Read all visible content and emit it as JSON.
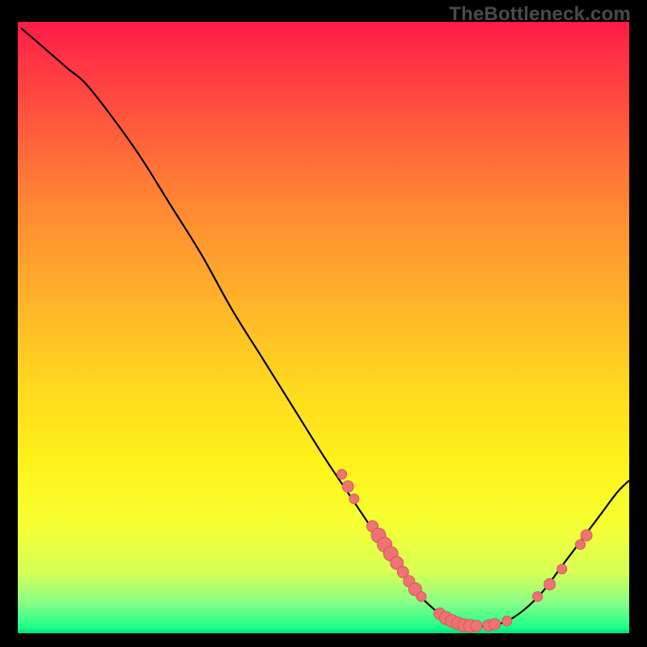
{
  "watermark_text": "TheBottleneck.com",
  "chart_data": {
    "type": "line",
    "title": "",
    "xlabel": "",
    "ylabel": "",
    "xlim": [
      0,
      100
    ],
    "ylim": [
      0,
      100
    ],
    "curve": [
      {
        "x": 0.5,
        "y": 99
      },
      {
        "x": 4,
        "y": 96
      },
      {
        "x": 8,
        "y": 92.5
      },
      {
        "x": 11,
        "y": 90
      },
      {
        "x": 15,
        "y": 85
      },
      {
        "x": 20,
        "y": 78
      },
      {
        "x": 25,
        "y": 70
      },
      {
        "x": 30,
        "y": 62
      },
      {
        "x": 35,
        "y": 53
      },
      {
        "x": 40,
        "y": 45
      },
      {
        "x": 45,
        "y": 37
      },
      {
        "x": 50,
        "y": 29
      },
      {
        "x": 54,
        "y": 23
      },
      {
        "x": 58,
        "y": 17
      },
      {
        "x": 62,
        "y": 11
      },
      {
        "x": 65,
        "y": 7
      },
      {
        "x": 68,
        "y": 4
      },
      {
        "x": 71,
        "y": 2
      },
      {
        "x": 74,
        "y": 1.2
      },
      {
        "x": 77,
        "y": 1.2
      },
      {
        "x": 80,
        "y": 2
      },
      {
        "x": 83,
        "y": 4
      },
      {
        "x": 86,
        "y": 7
      },
      {
        "x": 89,
        "y": 11
      },
      {
        "x": 92,
        "y": 15
      },
      {
        "x": 95,
        "y": 19
      },
      {
        "x": 98,
        "y": 23
      },
      {
        "x": 100,
        "y": 25
      }
    ],
    "dots": [
      {
        "x": 53,
        "y": 26,
        "r": 6
      },
      {
        "x": 54,
        "y": 24,
        "r": 7
      },
      {
        "x": 55,
        "y": 22,
        "r": 6
      },
      {
        "x": 58,
        "y": 17.5,
        "r": 7
      },
      {
        "x": 59,
        "y": 16,
        "r": 9
      },
      {
        "x": 60,
        "y": 14.5,
        "r": 9
      },
      {
        "x": 61,
        "y": 13,
        "r": 9
      },
      {
        "x": 62,
        "y": 11.5,
        "r": 8
      },
      {
        "x": 63,
        "y": 10,
        "r": 7
      },
      {
        "x": 64,
        "y": 8.5,
        "r": 7
      },
      {
        "x": 65,
        "y": 7.2,
        "r": 8
      },
      {
        "x": 66,
        "y": 6,
        "r": 6
      },
      {
        "x": 69,
        "y": 3.2,
        "r": 7
      },
      {
        "x": 70,
        "y": 2.5,
        "r": 8
      },
      {
        "x": 71,
        "y": 2,
        "r": 8
      },
      {
        "x": 72,
        "y": 1.6,
        "r": 8
      },
      {
        "x": 73,
        "y": 1.3,
        "r": 8
      },
      {
        "x": 74,
        "y": 1.2,
        "r": 8
      },
      {
        "x": 75,
        "y": 1.2,
        "r": 7
      },
      {
        "x": 77,
        "y": 1.3,
        "r": 7
      },
      {
        "x": 78,
        "y": 1.5,
        "r": 7
      },
      {
        "x": 80,
        "y": 2,
        "r": 6
      },
      {
        "x": 85,
        "y": 6,
        "r": 6
      },
      {
        "x": 87,
        "y": 8,
        "r": 7
      },
      {
        "x": 89,
        "y": 10.5,
        "r": 6
      },
      {
        "x": 92,
        "y": 14.5,
        "r": 6
      },
      {
        "x": 93,
        "y": 16,
        "r": 7
      }
    ]
  }
}
